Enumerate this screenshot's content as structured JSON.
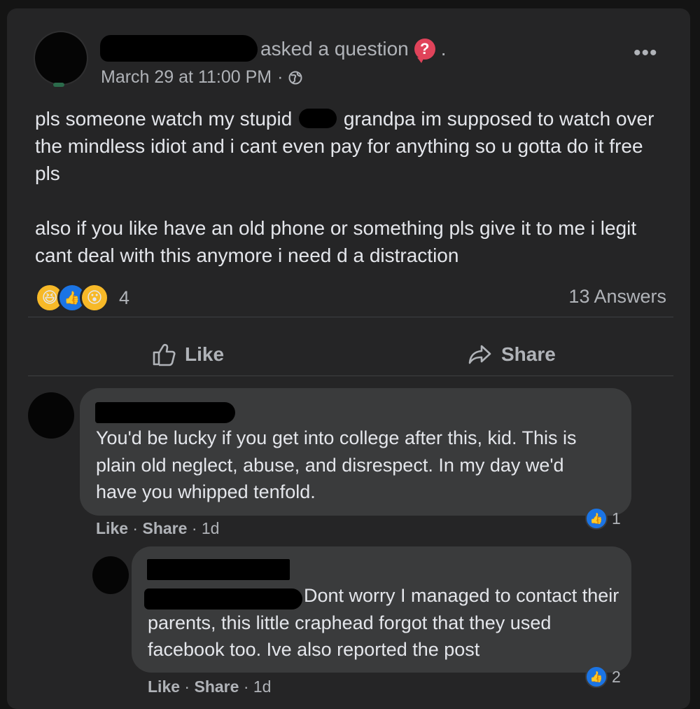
{
  "post": {
    "author_redacted": true,
    "asked_text": "asked a question",
    "asked_suffix": ".",
    "question_icon": "?",
    "date": "March 29 at 11:00 PM",
    "date_separator": "·",
    "privacy_icon": "globe-icon",
    "more_icon": "•••",
    "text_line_1_before": "pls someone watch my stupid",
    "text_line_1_after": "grandpa im supposed to watch over the mindless idiot and i cant even pay for anything so u gotta do it free pls",
    "text_paragraph_2": "also if you like have an old phone or something pls give it to me i legit cant deal with this anymore i need d a distraction",
    "reactions": [
      "haha",
      "like",
      "wow"
    ],
    "reaction_count": "4",
    "answers": "13 Answers"
  },
  "actions": {
    "like_label": "Like",
    "share_label": "Share"
  },
  "comments": [
    {
      "author_redacted": true,
      "text": "You'd be lucky if you get into college after this, kid. This is plain old neglect, abuse, and disrespect. In my day we'd have you whipped tenfold.",
      "like": "Like",
      "share": "Share",
      "sep": "·",
      "time": "1d",
      "like_count": "1"
    },
    {
      "author_redacted": true,
      "text": "Dont worry I managed to contact their parents, this little craphead forgot that they used facebook too. Ive also reported the post",
      "like": "Like",
      "share": "Share",
      "sep": "·",
      "time": "1d",
      "like_count": "2"
    }
  ],
  "colors": {
    "background": "#141414",
    "card": "#252526",
    "bubble": "#3a3b3c",
    "text": "#e4e6eb",
    "secondary_text": "#b0b3b8",
    "like_blue": "#1b74e4",
    "question_red": "#e0435a"
  }
}
